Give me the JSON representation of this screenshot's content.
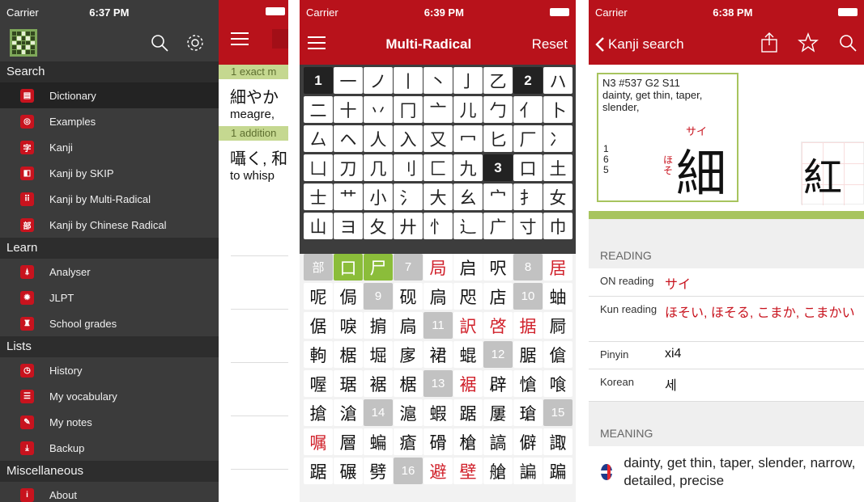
{
  "panel1": {
    "status": {
      "carrier": "Carrier",
      "time": "6:37 PM"
    },
    "menu": {
      "sections": [
        {
          "title": "Search",
          "items": [
            "Dictionary",
            "Examples",
            "Kanji",
            "Kanji by SKIP",
            "Kanji by Multi-Radical",
            "Kanji by Chinese Radical"
          ]
        },
        {
          "title": "Learn",
          "items": [
            "Analyser",
            "JLPT",
            "School grades"
          ]
        },
        {
          "title": "Lists",
          "items": [
            "History",
            "My vocabulary",
            "My notes",
            "Backup"
          ]
        },
        {
          "title": "Miscellaneous",
          "items": [
            "About"
          ]
        }
      ],
      "icons": [
        "dictionary-icon",
        "examples-icon",
        "kanji-icon",
        "skip-icon",
        "multi-radical-icon",
        "chinese-radical-icon",
        "analyser-icon",
        "jlpt-icon",
        "school-grades-icon",
        "history-icon",
        "vocabulary-icon",
        "notes-icon",
        "backup-icon",
        "about-icon"
      ],
      "icon_glyphs": [
        "▤",
        "◎",
        "字",
        "◧",
        "⠿",
        "部",
        "⍋",
        "✹",
        "♜",
        "◷",
        "☰",
        "✎",
        "⤓",
        "i"
      ]
    },
    "results": {
      "exact_header": "1 exact m",
      "row1_kanji": "細やか",
      "row1_meaning": "meagre,",
      "additional_header": "1 addition",
      "row2_kanji": "囁く, 和",
      "row2_meaning": "to whisp"
    },
    "accent": "#b8121b"
  },
  "panel2": {
    "status": {
      "carrier": "Carrier",
      "time": "6:39 PM"
    },
    "title": "Multi-Radical",
    "reset_label": "Reset",
    "radicals": [
      {
        "t": "1",
        "num": true
      },
      {
        "t": "一"
      },
      {
        "t": "ノ"
      },
      {
        "t": "丨"
      },
      {
        "t": "丶"
      },
      {
        "t": "亅"
      },
      {
        "t": "乙"
      },
      {
        "t": "2",
        "num": true
      },
      {
        "t": "ハ"
      },
      {
        "t": "二"
      },
      {
        "t": "十"
      },
      {
        "t": "丷"
      },
      {
        "t": "冂"
      },
      {
        "t": "亠"
      },
      {
        "t": "儿"
      },
      {
        "t": "勹"
      },
      {
        "t": "亻"
      },
      {
        "t": "卜"
      },
      {
        "t": "厶"
      },
      {
        "t": "ヘ"
      },
      {
        "t": "人"
      },
      {
        "t": "入"
      },
      {
        "t": "又"
      },
      {
        "t": "冖"
      },
      {
        "t": "匕"
      },
      {
        "t": "厂"
      },
      {
        "t": "冫"
      },
      {
        "t": "凵"
      },
      {
        "t": "刀"
      },
      {
        "t": "几"
      },
      {
        "t": "刂"
      },
      {
        "t": "匚"
      },
      {
        "t": "九"
      },
      {
        "t": "3",
        "num": true
      },
      {
        "t": "口"
      },
      {
        "t": "土"
      },
      {
        "t": "士"
      },
      {
        "t": "艹"
      },
      {
        "t": "小"
      },
      {
        "t": "氵"
      },
      {
        "t": "大"
      },
      {
        "t": "幺"
      },
      {
        "t": "宀"
      },
      {
        "t": "扌"
      },
      {
        "t": "女"
      },
      {
        "t": "山"
      },
      {
        "t": "ヨ"
      },
      {
        "t": "夂"
      },
      {
        "t": "廾"
      },
      {
        "t": "忄"
      },
      {
        "t": "辶"
      },
      {
        "t": "广"
      },
      {
        "t": "寸"
      },
      {
        "t": "巾"
      }
    ],
    "kanji": [
      {
        "t": "部",
        "k": "rad"
      },
      {
        "t": "口",
        "k": "green"
      },
      {
        "t": "尸",
        "k": "green"
      },
      {
        "t": "7",
        "k": "num"
      },
      {
        "t": "局",
        "k": "red"
      },
      {
        "t": "启"
      },
      {
        "t": "呎"
      },
      {
        "t": "8",
        "k": "num"
      },
      {
        "t": "居",
        "k": "red"
      },
      {
        "t": "呢"
      },
      {
        "t": "侷"
      },
      {
        "t": "9",
        "k": "num"
      },
      {
        "t": "砚"
      },
      {
        "t": "扃"
      },
      {
        "t": "咫"
      },
      {
        "t": "店"
      },
      {
        "t": "10",
        "k": "num"
      },
      {
        "t": "蚰"
      },
      {
        "t": "倨"
      },
      {
        "t": "唳"
      },
      {
        "t": "掮"
      },
      {
        "t": "扃"
      },
      {
        "t": "11",
        "k": "num"
      },
      {
        "t": "訳",
        "k": "red"
      },
      {
        "t": "啓",
        "k": "red"
      },
      {
        "t": "据",
        "k": "red"
      },
      {
        "t": "屙"
      },
      {
        "t": "軥"
      },
      {
        "t": "椐"
      },
      {
        "t": "堀"
      },
      {
        "t": "扅"
      },
      {
        "t": "裙"
      },
      {
        "t": "蜫"
      },
      {
        "t": "12",
        "k": "num"
      },
      {
        "t": "腒"
      },
      {
        "t": "傖"
      },
      {
        "t": "喔"
      },
      {
        "t": "琚"
      },
      {
        "t": "裾"
      },
      {
        "t": "椐"
      },
      {
        "t": "13",
        "k": "num"
      },
      {
        "t": "裾",
        "k": "red"
      },
      {
        "t": "辟"
      },
      {
        "t": "愴"
      },
      {
        "t": "喰"
      },
      {
        "t": "搶"
      },
      {
        "t": "滄"
      },
      {
        "t": "14",
        "k": "num"
      },
      {
        "t": "滬"
      },
      {
        "t": "蝦"
      },
      {
        "t": "踞"
      },
      {
        "t": "屢"
      },
      {
        "t": "瑲"
      },
      {
        "t": "15",
        "k": "num"
      },
      {
        "t": "嘱",
        "k": "red"
      },
      {
        "t": "層"
      },
      {
        "t": "蝙"
      },
      {
        "t": "瘡"
      },
      {
        "t": "磆"
      },
      {
        "t": "槍"
      },
      {
        "t": "謞"
      },
      {
        "t": "僻"
      },
      {
        "t": "諏"
      },
      {
        "t": "踞"
      },
      {
        "t": "碾"
      },
      {
        "t": "劈"
      },
      {
        "t": "16",
        "k": "num"
      },
      {
        "t": "避",
        "k": "red"
      },
      {
        "t": "壁",
        "k": "red"
      },
      {
        "t": "艙"
      },
      {
        "t": "諞"
      },
      {
        "t": "蹁"
      }
    ]
  },
  "panel3": {
    "status": {
      "carrier": "Carrier",
      "time": "6:38 PM"
    },
    "back_label": "Kanji search",
    "card": {
      "header": "N3  #537   G2  S11",
      "meaning": "dainty, get thin, taper, slender,",
      "on": "サイ",
      "strokes": "1\n6\n5",
      "kun": "ほ\nそ",
      "kanji": "細"
    },
    "stroke_preview": "紅",
    "reading_header": "READING",
    "readings": [
      {
        "label": "ON reading",
        "value": "サイ"
      },
      {
        "label": "Kun reading",
        "value": "ほそい, ほそる, こまか, こまかい"
      },
      {
        "label": "Pinyin",
        "value": "xi4"
      },
      {
        "label": "Korean",
        "value": "세"
      }
    ],
    "meaning_header": "MEANING",
    "meaning_text": "dainty, get thin, taper, slender, narrow, detailed, precise"
  }
}
